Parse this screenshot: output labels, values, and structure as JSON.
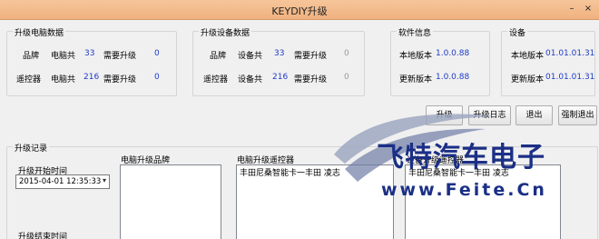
{
  "window": {
    "title": "KEYDIY升级",
    "minimize": "–",
    "close": "×"
  },
  "pc_group": {
    "title": "升级电脑数据",
    "rows": [
      {
        "label": "品牌",
        "count_label": "电脑共",
        "count": "33",
        "need_label": "需要升级",
        "need": "0"
      },
      {
        "label": "遥控器",
        "count_label": "电脑共",
        "count": "216",
        "need_label": "需要升级",
        "need": "0"
      }
    ]
  },
  "device_group": {
    "title": "升级设备数据",
    "rows": [
      {
        "label": "品牌",
        "count_label": "设备共",
        "count": "33",
        "need_label": "需要升级",
        "need": "0"
      },
      {
        "label": "遥控器",
        "count_label": "设备共",
        "count": "216",
        "need_label": "需要升级",
        "need": "0"
      }
    ]
  },
  "software_group": {
    "title": "软件信息",
    "local_label": "本地版本",
    "local_value": "1.0.0.88",
    "update_label": "更新版本",
    "update_value": "1.0.0.88"
  },
  "device_info_group": {
    "title": "设备",
    "local_label": "本地版本",
    "local_value": "01.01.01.31",
    "update_label": "更新版本",
    "update_value": "01.01.01.31"
  },
  "buttons": {
    "upgrade": "升级",
    "upgrade_log": "升级日志",
    "exit": "退出",
    "force_exit": "强制退出"
  },
  "record_group": {
    "title": "升级记录",
    "start_time_label": "升级开始时间",
    "start_time_value": "2015-04-01 12:35:33",
    "end_time_label": "升级结束时间"
  },
  "lists": {
    "pc_brand": {
      "label": "电脑升级品牌",
      "items": []
    },
    "pc_remote": {
      "label": "电脑升级遥控器",
      "items": [
        "丰田尼桑智能卡一丰田 凌志"
      ]
    },
    "device_remote": {
      "label": "设备升级遥控器",
      "items": [
        "丰田尼桑智能卡一丰田 凌志"
      ]
    }
  },
  "watermark": {
    "company": "飞特汽车电子",
    "url": "www.Feite.Cn"
  }
}
